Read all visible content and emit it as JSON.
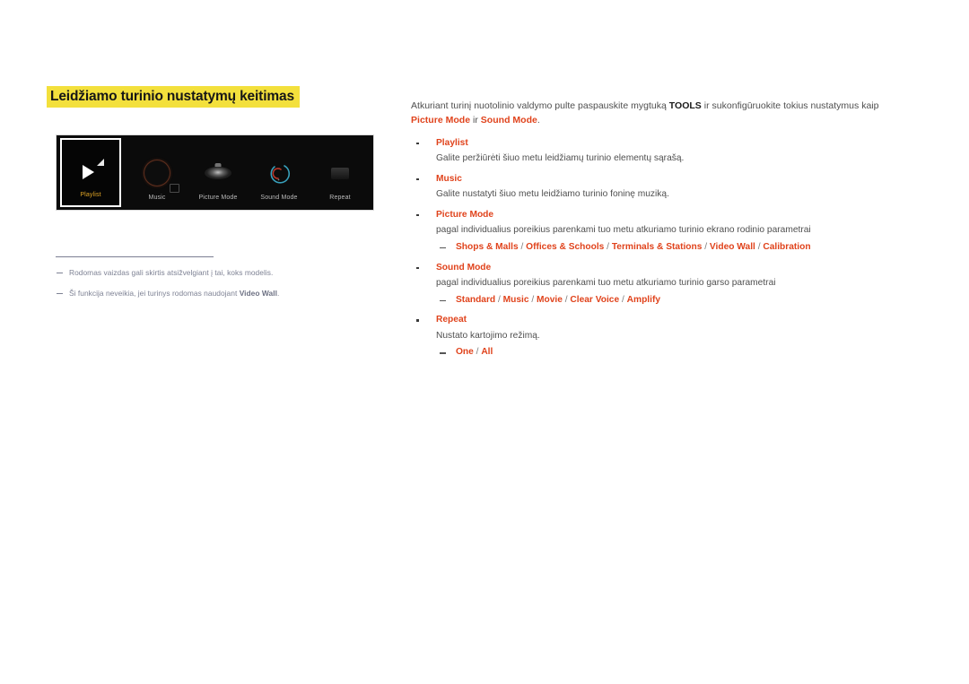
{
  "document": {
    "heading": "Leidžiamo turinio nustatymų keitimas",
    "highlight_color": "#f3e03c",
    "accent_color": "#e0431c"
  },
  "screen_mock": {
    "background_color": "#0b0b0b",
    "selected_tile_color": "#e0a526",
    "tiles": [
      {
        "label": "Playlist",
        "icon": "play-icon",
        "selected": true
      },
      {
        "label": "Music",
        "icon": "music-disc-icon",
        "selected": false
      },
      {
        "label": "Picture Mode",
        "icon": "picture-mode-icon",
        "selected": false
      },
      {
        "label": "Sound Mode",
        "icon": "sound-mode-icon",
        "selected": false
      },
      {
        "label": "Repeat",
        "icon": "repeat-icon",
        "selected": false
      }
    ]
  },
  "notes": [
    {
      "text_before": "Rodomas vaizdas gali skirtis atsižvelgiant į tai, koks modelis.",
      "bold": "",
      "text_after": ""
    },
    {
      "text_before": "Ši funkcija neveikia, jei turinys rodomas naudojant ",
      "bold": "Video Wall",
      "text_after": "."
    }
  ],
  "intro": {
    "part1": "Atkuriant turinį nuotolinio valdymo pulte paspauskite mygtuką ",
    "kbd": "TOOLS",
    "part2": " ir sukonfigūruokite tokius nustatymus kaip ",
    "hl1": "Picture Mode",
    "part3": " ir ",
    "hl2": "Sound Mode",
    "part4": "."
  },
  "bullets": [
    {
      "title": "Playlist",
      "desc": "Galite peržiūrėti šiuo metu leidžiamų turinio elementų sąrašą.",
      "options": []
    },
    {
      "title": "Music",
      "desc": "Galite nustatyti šiuo metu leidžiamo turinio foninę muziką.",
      "options": []
    },
    {
      "title": "Picture Mode",
      "desc": "pagal individualius poreikius parenkami tuo metu atkuriamo turinio ekrano rodinio parametrai",
      "options": [
        "Shops & Malls",
        "Offices & Schools",
        "Terminals & Stations",
        "Video Wall",
        "Calibration"
      ]
    },
    {
      "title": "Sound Mode",
      "desc": "pagal individualius poreikius parenkami tuo metu atkuriamo turinio garso parametrai",
      "options": [
        "Standard",
        "Music",
        "Movie",
        "Clear Voice",
        "Amplify"
      ]
    },
    {
      "title": "Repeat",
      "desc": "Nustato kartojimo režimą.",
      "options": [
        "One",
        "All"
      ]
    }
  ]
}
